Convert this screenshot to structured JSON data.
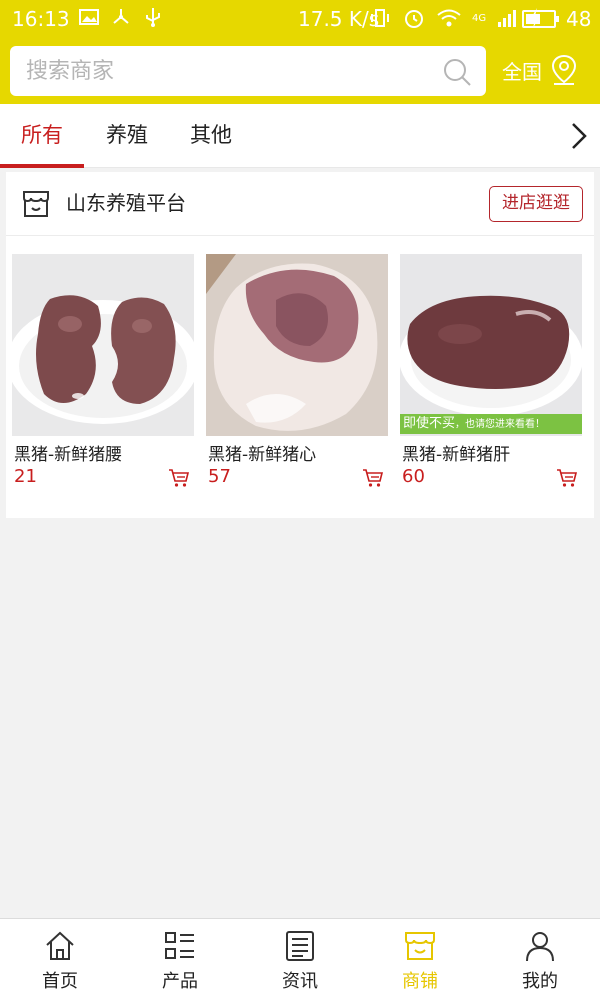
{
  "status_bar": {
    "time": "16:13",
    "speed": "17.5 K/s",
    "battery": "48",
    "network": "4G"
  },
  "search": {
    "placeholder": "搜索商家",
    "region_label": "全国"
  },
  "tabs": [
    {
      "label": "所有",
      "active": true
    },
    {
      "label": "养殖",
      "active": false
    },
    {
      "label": "其他",
      "active": false
    }
  ],
  "shop": {
    "name": "山东养殖平台",
    "visit_label": "进店逛逛",
    "products": [
      {
        "name": "黑猪-新鲜猪腰",
        "price": "21"
      },
      {
        "name": "黑猪-新鲜猪心",
        "price": "57"
      },
      {
        "name": "黑猪-新鲜猪肝",
        "price": "60"
      }
    ],
    "banner_main": "即使不买",
    "banner_sub": "，也请您进来看看！"
  },
  "bottom_nav": [
    {
      "label": "首页",
      "icon": "home-icon",
      "active": false
    },
    {
      "label": "产品",
      "icon": "list-icon",
      "active": false
    },
    {
      "label": "资讯",
      "icon": "news-icon",
      "active": false
    },
    {
      "label": "商铺",
      "icon": "store-icon",
      "active": true
    },
    {
      "label": "我的",
      "icon": "user-icon",
      "active": false
    }
  ],
  "colors": {
    "brand_yellow": "#e6d800",
    "accent_red": "#c81e1e",
    "nav_active": "#e6c600"
  }
}
